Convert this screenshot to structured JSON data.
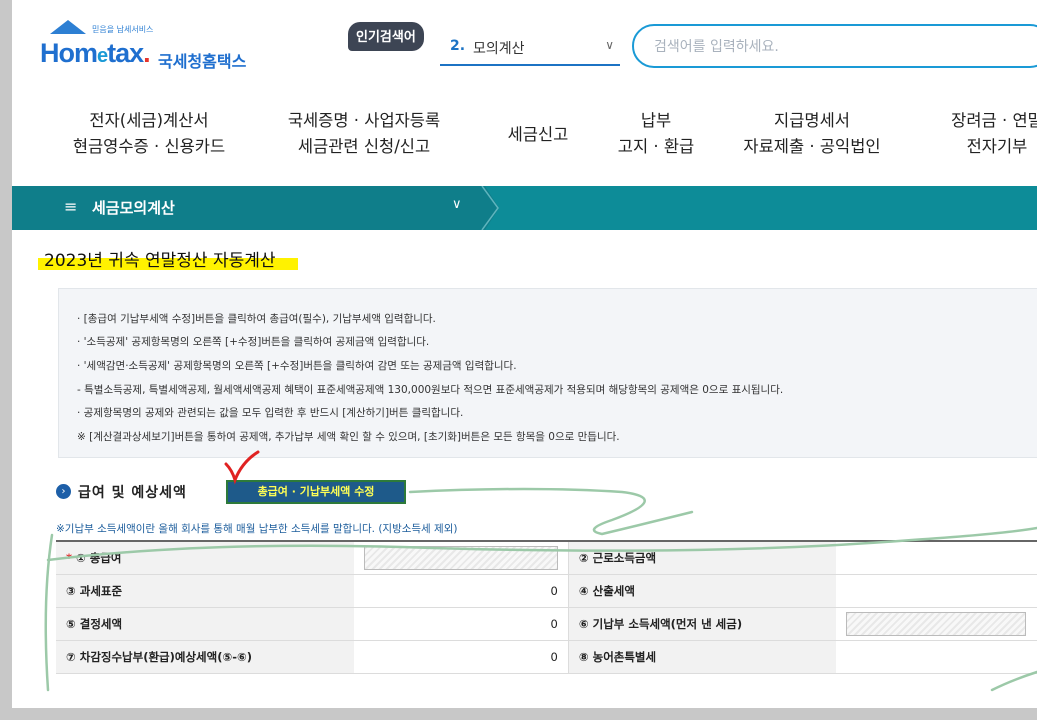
{
  "header": {
    "logo_tagline": "믿음을 납세서비스",
    "logo_word_prefix": "Hom",
    "logo_word_e": "e",
    "logo_word_suffix": "tax",
    "logo_dot": ".",
    "logo_korean": "국세청홈택스",
    "popular_badge": "인기검색어",
    "popular_rank": "2.",
    "popular_term": "모의계산",
    "search_placeholder": "검색어를 입력하세요."
  },
  "nav": [
    {
      "line1": "전자(세금)계산서",
      "line2": "현금영수증 · 신용카드"
    },
    {
      "line1": "국세증명 · 사업자등록",
      "line2": "세금관련 신청/신고"
    },
    {
      "line1": "세금신고",
      "line2": ""
    },
    {
      "line1": "납부",
      "line2": "고지 · 환급"
    },
    {
      "line1": "지급명세서",
      "line2": "자료제출 · 공익법인"
    },
    {
      "line1": "장려금 · 연말",
      "line2": "전자기부"
    }
  ],
  "section": {
    "title": "세금모의계산"
  },
  "page_title": "2023년 귀속 연말정산 자동계산",
  "notice_lines": [
    "· [총급여 기납부세액 수정]버튼을 클릭하여 총급여(필수), 기납부세액 입력합니다.",
    "· '소득공제' 공제항목명의 오른쪽 [+수정]버튼을 클릭하여 공제금액 입력합니다.",
    "· '세액감면·소득공제' 공제항목명의 오른쪽 [+수정]버튼을 클릭하여 감면 또는 공제금액 입력합니다.",
    "  - 특별소득공제, 특별세액공제, 월세액세액공제 혜택이 표준세액공제액 130,000원보다 적으면 표준세액공제가 적용되며 해당항목의 공제액은 0으로 표시됩니다.",
    "· 공제항목명의 공제와 관련되는 값을 모두 입력한 후 반드시 [계산하기]버튼 클릭합니다.",
    "  ※ [계산결과상세보기]버튼을 통하여 공제액, 추가납부 세액 확인 할 수 있으며, [초기화]버튼은 모든 항목을 0으로 만듭니다."
  ],
  "salary": {
    "heading": "급여 및 예상세액",
    "edit_button": "총급여 · 기납부세액 수정",
    "note": "※기납부 소득세액이란 올해 회사를 통해 매월 납부한 소득세를 말합니다. (지방소득세 제외)"
  },
  "table": {
    "rows": [
      {
        "label1": "① 총급여",
        "required": "*",
        "value1": "",
        "label2": "② 근로소득금액",
        "value2": ""
      },
      {
        "label1": "③ 과세표준",
        "value1": "0",
        "label2": "④ 산출세액",
        "value2": ""
      },
      {
        "label1": "⑤ 결정세액",
        "value1": "0",
        "label2": "⑥ 기납부 소득세액(먼저 낸 세금)",
        "value2": ""
      },
      {
        "label1": "⑦ 차감징수납부(환급)예상세액(⑤-⑥)",
        "value1": "0",
        "label2": "⑧ 농어촌특별세",
        "value2": ""
      }
    ]
  }
}
